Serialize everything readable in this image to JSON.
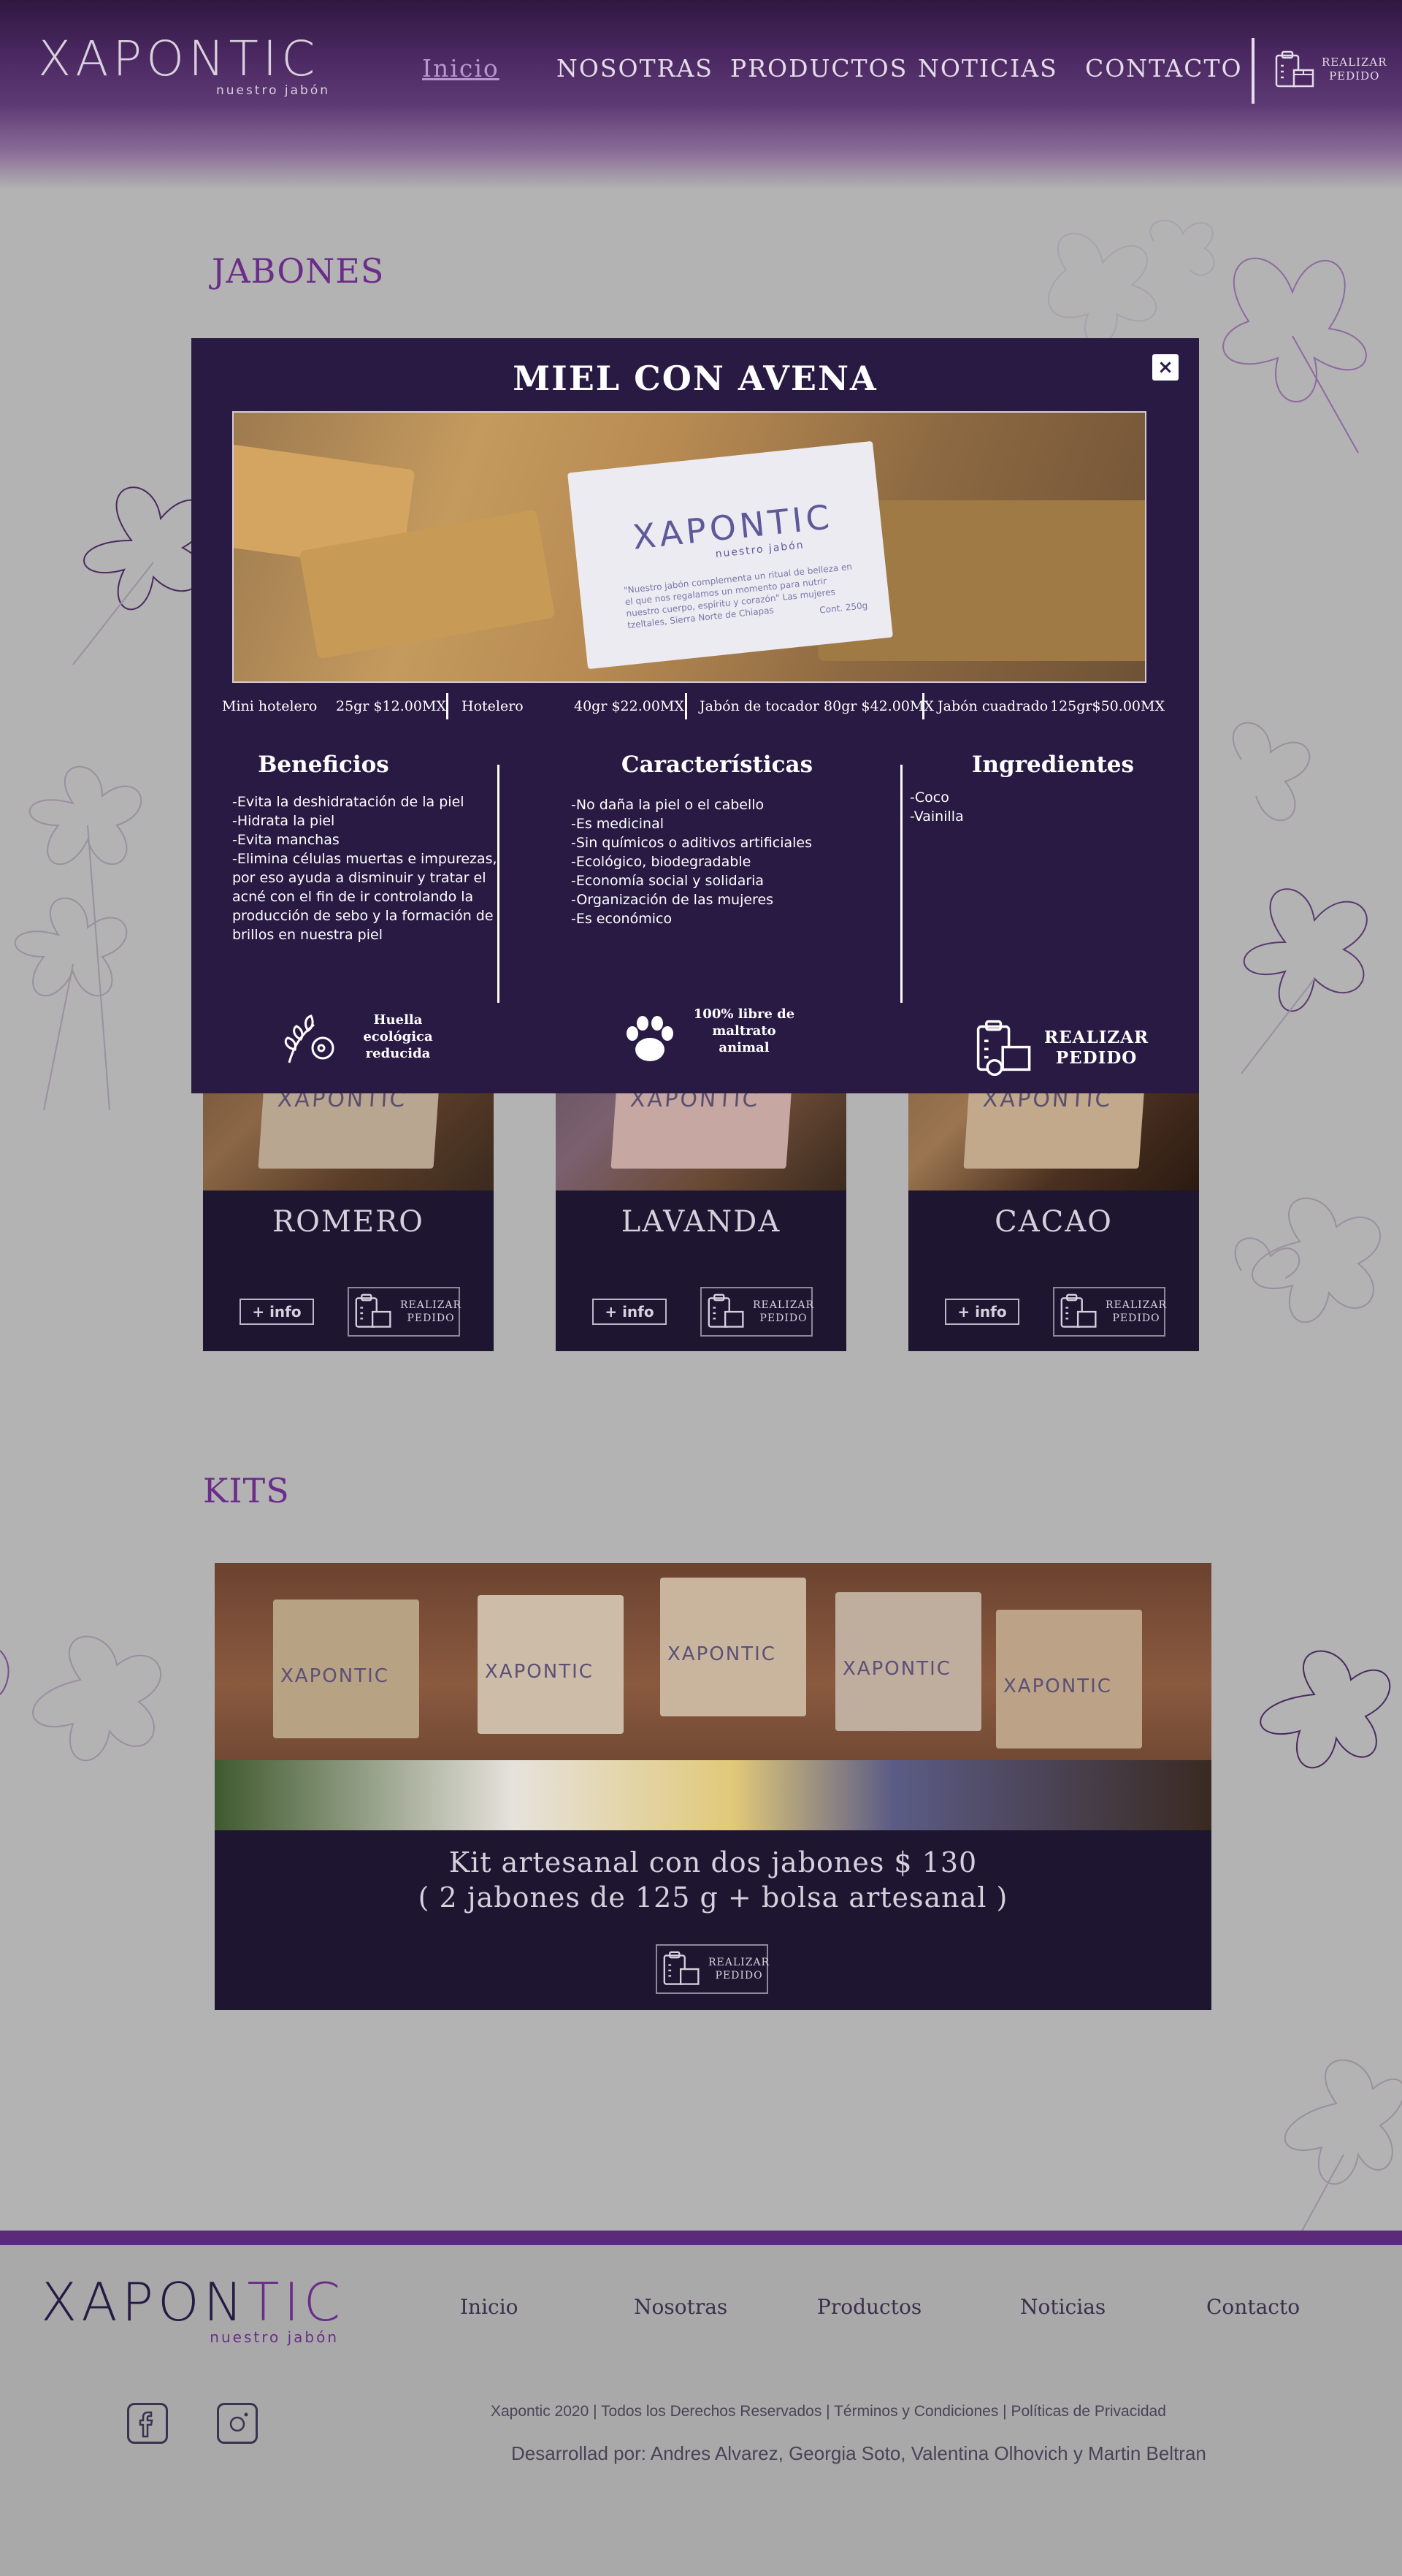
{
  "header": {
    "logo": {
      "word": "XAPONTIC",
      "sub": "nuestro jabón"
    },
    "nav": [
      "Inicio",
      "NOSOTRAS",
      "PRODUCTOS",
      "NOTICIAS",
      "CONTACTO"
    ],
    "order_label_1": "REALIZAR",
    "order_label_2": "PEDIDO"
  },
  "sections": {
    "soaps_title": "JABONES",
    "kits_title": "KITS"
  },
  "cards": [
    {
      "name": "ROMERO",
      "info": "+ info",
      "order_1": "REALIZAR",
      "order_2": "PEDIDO"
    },
    {
      "name": "LAVANDA",
      "info": "+ info",
      "order_1": "REALIZAR",
      "order_2": "PEDIDO"
    },
    {
      "name": "CACAO",
      "info": "+ info",
      "order_1": "REALIZAR",
      "order_2": "PEDIDO"
    }
  ],
  "kit": {
    "line1": "Kit artesanal con dos jabones $ 130",
    "line2": "( 2 jabones de 125 g + bolsa artesanal )",
    "order_1": "REALIZAR",
    "order_2": "PEDIDO",
    "box_brand": "XAPONTIC"
  },
  "modal": {
    "title": "MIEL CON AVENA",
    "close": "×",
    "photo_brand": "XAPONTIC",
    "photo_sub": "nuestro jabón",
    "photo_text": "\"Nuestro jabón complementa un ritual de belleza en el que nos regalamos un momento para nutrir nuestro cuerpo, espíritu y corazón\" Las mujeres tzeltales, Sierra Norte de Chiapas",
    "photo_cont": "Cont. 250g",
    "sizes": [
      {
        "name": "Mini hotelero",
        "price": "25gr $12.00MX"
      },
      {
        "name": "Hotelero",
        "price": "40gr $22.00MX"
      },
      {
        "name": "Jabón de tocador 80gr $42.00MX",
        "price": ""
      },
      {
        "name": "Jabón cuadrado",
        "price": "125gr$50.00MX"
      }
    ],
    "benefits": {
      "title": "Beneficios",
      "items": [
        "-Evita la deshidratación de la piel",
        "-Hidrata la piel",
        "-Evita manchas",
        "-Elimina células muertas e impurezas,",
        "por eso ayuda a disminuir y tratar el",
        "acné con el fin de ir controlando la",
        "producción de sebo y la formación de",
        "brillos en nuestra piel"
      ]
    },
    "features": {
      "title": "Características",
      "items": [
        "-No daña la piel o el cabello",
        "-Es medicinal",
        "-Sin químicos o aditivos artificiales",
        "-Ecológico, biodegradable",
        "-Economía social y solidaria",
        "-Organización de las mujeres",
        "-Es económico"
      ]
    },
    "ingredients": {
      "title": "Ingredientes",
      "items": [
        "-Coco",
        "-Vainilla"
      ]
    },
    "badge_1": [
      "Huella",
      "ecológica",
      "reducida"
    ],
    "badge_2": [
      "100% libre de",
      "maltrato",
      "animal"
    ],
    "order_1": "REALIZAR",
    "order_2": "PEDIDO"
  },
  "footer": {
    "logo_a": "XAPON",
    "logo_b": "TIC",
    "sub": "nuestro jabón",
    "nav": [
      "Inicio",
      "Nosotras",
      "Productos",
      "Noticias",
      "Contacto"
    ],
    "copyright": "Xapontic 2020 | Todos los Derechos Reservados | Términos y Condiciones | Políticas de Privacidad",
    "developers": "Desarrollad por: Andres Alvarez, Georgia Soto, Valentina Olhovich y Martin Beltran"
  },
  "colors": {
    "accent": "#6b2c8a",
    "modal_bg": "#291a44",
    "card_bg": "#1e1630",
    "page_bg": "#b3b3b3"
  }
}
